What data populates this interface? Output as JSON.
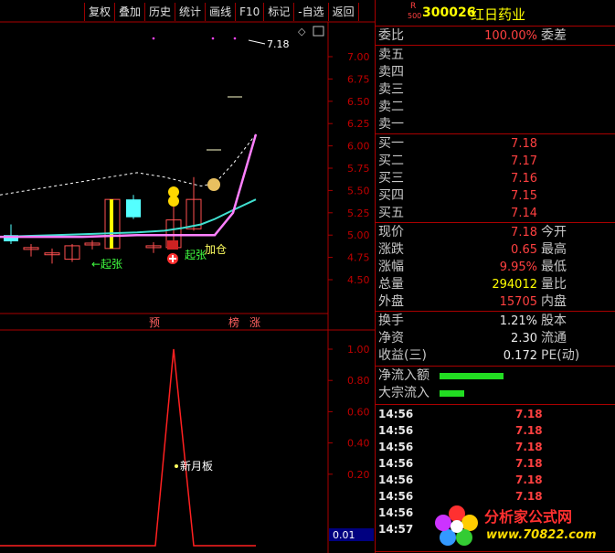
{
  "toolbar": [
    "复权",
    "叠加",
    "历史",
    "统计",
    "画线",
    "F10",
    "标记",
    "-自选",
    "返回"
  ],
  "header": {
    "badge_top": "R",
    "badge_bottom": "500",
    "code": "300026",
    "name": "红日药业"
  },
  "order_book": {
    "weibi_label": "委比",
    "weibi_value": "100.00%",
    "weicha_label": "委差",
    "sells": [
      {
        "label": "卖五",
        "value": ""
      },
      {
        "label": "卖四",
        "value": ""
      },
      {
        "label": "卖三",
        "value": ""
      },
      {
        "label": "卖二",
        "value": ""
      },
      {
        "label": "卖一",
        "value": ""
      }
    ],
    "buys": [
      {
        "label": "买一",
        "value": "7.18"
      },
      {
        "label": "买二",
        "value": "7.17"
      },
      {
        "label": "买三",
        "value": "7.16"
      },
      {
        "label": "买四",
        "value": "7.15"
      },
      {
        "label": "买五",
        "value": "7.14"
      }
    ]
  },
  "stats": [
    {
      "label": "现价",
      "value": "7.18",
      "label2": "今开",
      "color": "red"
    },
    {
      "label": "涨跌",
      "value": "0.65",
      "label2": "最高",
      "color": "red"
    },
    {
      "label": "涨幅",
      "value": "9.95%",
      "label2": "最低",
      "color": "red"
    },
    {
      "label": "总量",
      "value": "294012",
      "label2": "量比",
      "color": "yellow"
    },
    {
      "label": "外盘",
      "value": "15705",
      "label2": "内盘",
      "color": "red"
    }
  ],
  "stats2": [
    {
      "label": "换手",
      "value": "1.21%",
      "label2": "股本"
    },
    {
      "label": "净资",
      "value": "2.30",
      "label2": "流通"
    },
    {
      "label": "收益(三)",
      "value": "0.172",
      "label2": "PE(动)"
    }
  ],
  "flows": [
    {
      "label": "净流入额",
      "bar": 0.9
    },
    {
      "label": "大宗流入",
      "bar": 0.35
    }
  ],
  "ticks": [
    {
      "time": "14:56",
      "price": "7.18"
    },
    {
      "time": "14:56",
      "price": "7.18"
    },
    {
      "time": "14:56",
      "price": "7.18"
    },
    {
      "time": "14:56",
      "price": "7.18"
    },
    {
      "time": "14:56",
      "price": "7.18"
    },
    {
      "time": "14:56",
      "price": "7.18"
    },
    {
      "time": "14:56",
      "price": ""
    },
    {
      "time": "14:57",
      "price": ""
    }
  ],
  "chart": {
    "price_axis": [
      "7.00",
      "6.75",
      "6.50",
      "6.25",
      "6.00",
      "5.75",
      "5.50",
      "5.25",
      "5.00",
      "4.75",
      "4.50"
    ],
    "last_price_label": "7.18",
    "ind_axis": [
      "1.00",
      "0.80",
      "0.60",
      "0.40",
      "0.20"
    ],
    "ind_current": "0.01",
    "annotations": {
      "qizhang1": "←起张",
      "qizhang2": "起张",
      "jiacang": "加仓",
      "yu": "预",
      "bang": "榜",
      "zhang": "涨",
      "xinyueban": "新月板"
    }
  },
  "chart_data": {
    "type": "line",
    "title": "",
    "xlabel": "",
    "ylabel": "",
    "candles": [
      {
        "open": 5.0,
        "close": 4.93,
        "high": 5.12,
        "low": 4.9
      },
      {
        "open": 4.86,
        "close": 4.86,
        "high": 4.9,
        "low": 4.76
      },
      {
        "open": 4.8,
        "close": 4.8,
        "high": 4.85,
        "low": 4.68
      },
      {
        "open": 4.73,
        "close": 4.88,
        "high": 4.9,
        "low": 4.7
      },
      {
        "open": 4.91,
        "close": 4.91,
        "high": 4.94,
        "low": 4.84
      },
      {
        "open": 4.85,
        "close": 5.4,
        "high": 5.4,
        "low": 4.85
      },
      {
        "open": 5.4,
        "close": 5.2,
        "high": 5.45,
        "low": 5.18
      },
      {
        "open": 4.88,
        "close": 4.88,
        "high": 4.92,
        "low": 4.8
      },
      {
        "open": 4.86,
        "close": 5.17,
        "high": 5.38,
        "low": 4.86
      },
      {
        "open": 5.07,
        "close": 5.4,
        "high": 5.65,
        "low": 5.05
      }
    ],
    "ma_short": [
      4.98,
      4.98,
      4.98,
      4.98,
      4.99,
      5.0,
      5.0,
      5.0,
      5.0,
      5.0,
      5.25,
      6.13
    ],
    "ma_mid": [
      4.98,
      4.99,
      5.0,
      5.01,
      5.02,
      5.03,
      5.05,
      5.08,
      5.12,
      5.18,
      5.28,
      5.4
    ],
    "ma_long": [
      5.45,
      5.5,
      5.55,
      5.6,
      5.65,
      5.7,
      5.65,
      5.6,
      5.55,
      5.58,
      5.8,
      6.13
    ],
    "indicator": {
      "x": [
        0,
        1,
        2,
        3,
        4,
        5,
        6,
        7,
        8,
        9,
        10,
        11
      ],
      "values": [
        0,
        0,
        0,
        0,
        0,
        0,
        0,
        0,
        1,
        0,
        0,
        0
      ],
      "ylim": [
        0,
        1.1
      ]
    },
    "ylim": [
      4.4,
      7.2
    ]
  }
}
